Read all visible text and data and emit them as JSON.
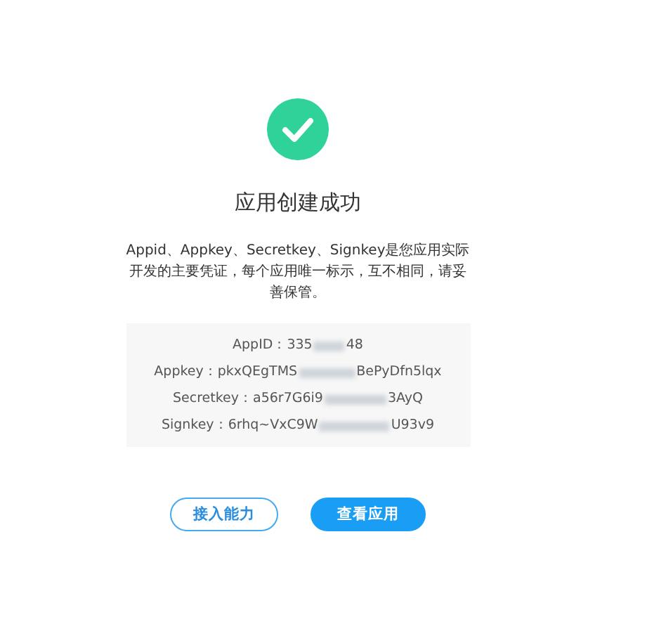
{
  "title": "应用创建成功",
  "description": "Appid、Appkey、Secretkey、Signkey是您应用实际开发的主要凭证，每个应用唯一标示，互不相同，请妥善保管。",
  "credentials": [
    {
      "label": "AppID：",
      "value_start": "335",
      "value_end": "48"
    },
    {
      "label": "Appkey：",
      "value_start": "pkxQEgTMS",
      "value_end": "BePyDfn5lqx"
    },
    {
      "label": "Secretkey：",
      "value_start": "a56r7G6i9",
      "value_end": "3AyQ"
    },
    {
      "label": "Signkey：",
      "value_start": "6rhq~VxC9W",
      "value_end": "U93v9"
    }
  ],
  "buttons": [
    {
      "label": "接入能力",
      "kind": "outline"
    },
    {
      "label": "查看应用",
      "kind": "primary"
    }
  ]
}
